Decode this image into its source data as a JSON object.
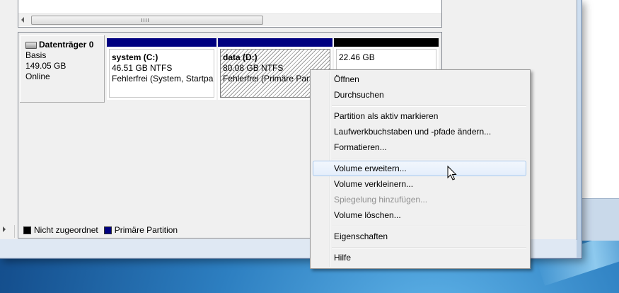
{
  "disk": {
    "name": "Datenträger 0",
    "type": "Basis",
    "size": "149.05 GB",
    "status": "Online"
  },
  "partitions": [
    {
      "name": "system  (C:)",
      "size": "46.51 GB NTFS",
      "status": "Fehlerfrei (System, Startpar"
    },
    {
      "name": "data  (D:)",
      "size": "80.08 GB NTFS",
      "status": "Fehlerfrei (Primäre Parti"
    },
    {
      "size": "22.46 GB"
    }
  ],
  "legend": {
    "unallocated": "Nicht zugeordnet",
    "primary": "Primäre Partition"
  },
  "context_menu": {
    "open": "Öffnen",
    "explore": "Durchsuchen",
    "mark_active": "Partition als aktiv markieren",
    "change_letter": "Laufwerkbuchstaben und -pfade ändern...",
    "format": "Formatieren...",
    "extend": "Volume erweitern...",
    "shrink": "Volume verkleinern...",
    "add_mirror": "Spiegelung hinzufügen...",
    "delete": "Volume löschen...",
    "properties": "Eigenschaften",
    "help": "Hilfe"
  },
  "colors": {
    "primary_partition": "#000080",
    "unallocated": "#000000",
    "menu_highlight_border": "#a8c8ec"
  }
}
